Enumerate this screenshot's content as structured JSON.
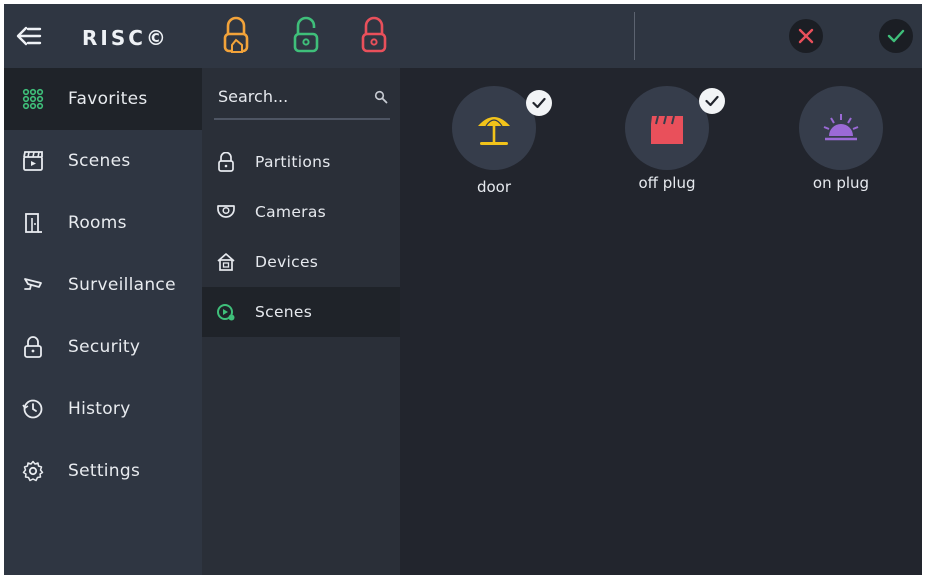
{
  "app": {
    "logo_text": "RISC©"
  },
  "topbar": {
    "lock_icons": [
      "lock-home-icon",
      "lock-open-icon",
      "lock-closed-icon"
    ],
    "colors": {
      "lock_home": "#f2a33a",
      "lock_open": "#3fbf7a",
      "lock_closed": "#e9505b",
      "cancel": "#e9505b",
      "confirm": "#3fbf7a"
    }
  },
  "sidebar": {
    "items": [
      {
        "label": "Favorites",
        "icon": "grid-icon",
        "active": true
      },
      {
        "label": "Scenes",
        "icon": "clapperboard-icon",
        "active": false
      },
      {
        "label": "Rooms",
        "icon": "door-icon",
        "active": false
      },
      {
        "label": "Surveillance",
        "icon": "camera-icon",
        "active": false
      },
      {
        "label": "Security",
        "icon": "lock-icon",
        "active": false
      },
      {
        "label": "History",
        "icon": "history-icon",
        "active": false
      },
      {
        "label": "Settings",
        "icon": "gear-icon",
        "active": false
      }
    ]
  },
  "middle": {
    "search": {
      "placeholder": "Search..."
    },
    "items": [
      {
        "label": "Partitions",
        "icon": "lock-icon",
        "active": false
      },
      {
        "label": "Cameras",
        "icon": "camera-icon",
        "active": false
      },
      {
        "label": "Devices",
        "icon": "house-icon",
        "active": false
      },
      {
        "label": "Scenes",
        "icon": "scene-icon",
        "active": true
      }
    ]
  },
  "content": {
    "tiles": [
      {
        "label": "door",
        "icon": "beach-umbrella-icon",
        "selected": true,
        "color": "#f2c31a"
      },
      {
        "label": "off plug",
        "icon": "clapperboard-icon",
        "selected": true,
        "color": "#e9505b"
      },
      {
        "label": "on plug",
        "icon": "sunrise-icon",
        "selected": false,
        "color": "#9b6ad6"
      }
    ]
  }
}
